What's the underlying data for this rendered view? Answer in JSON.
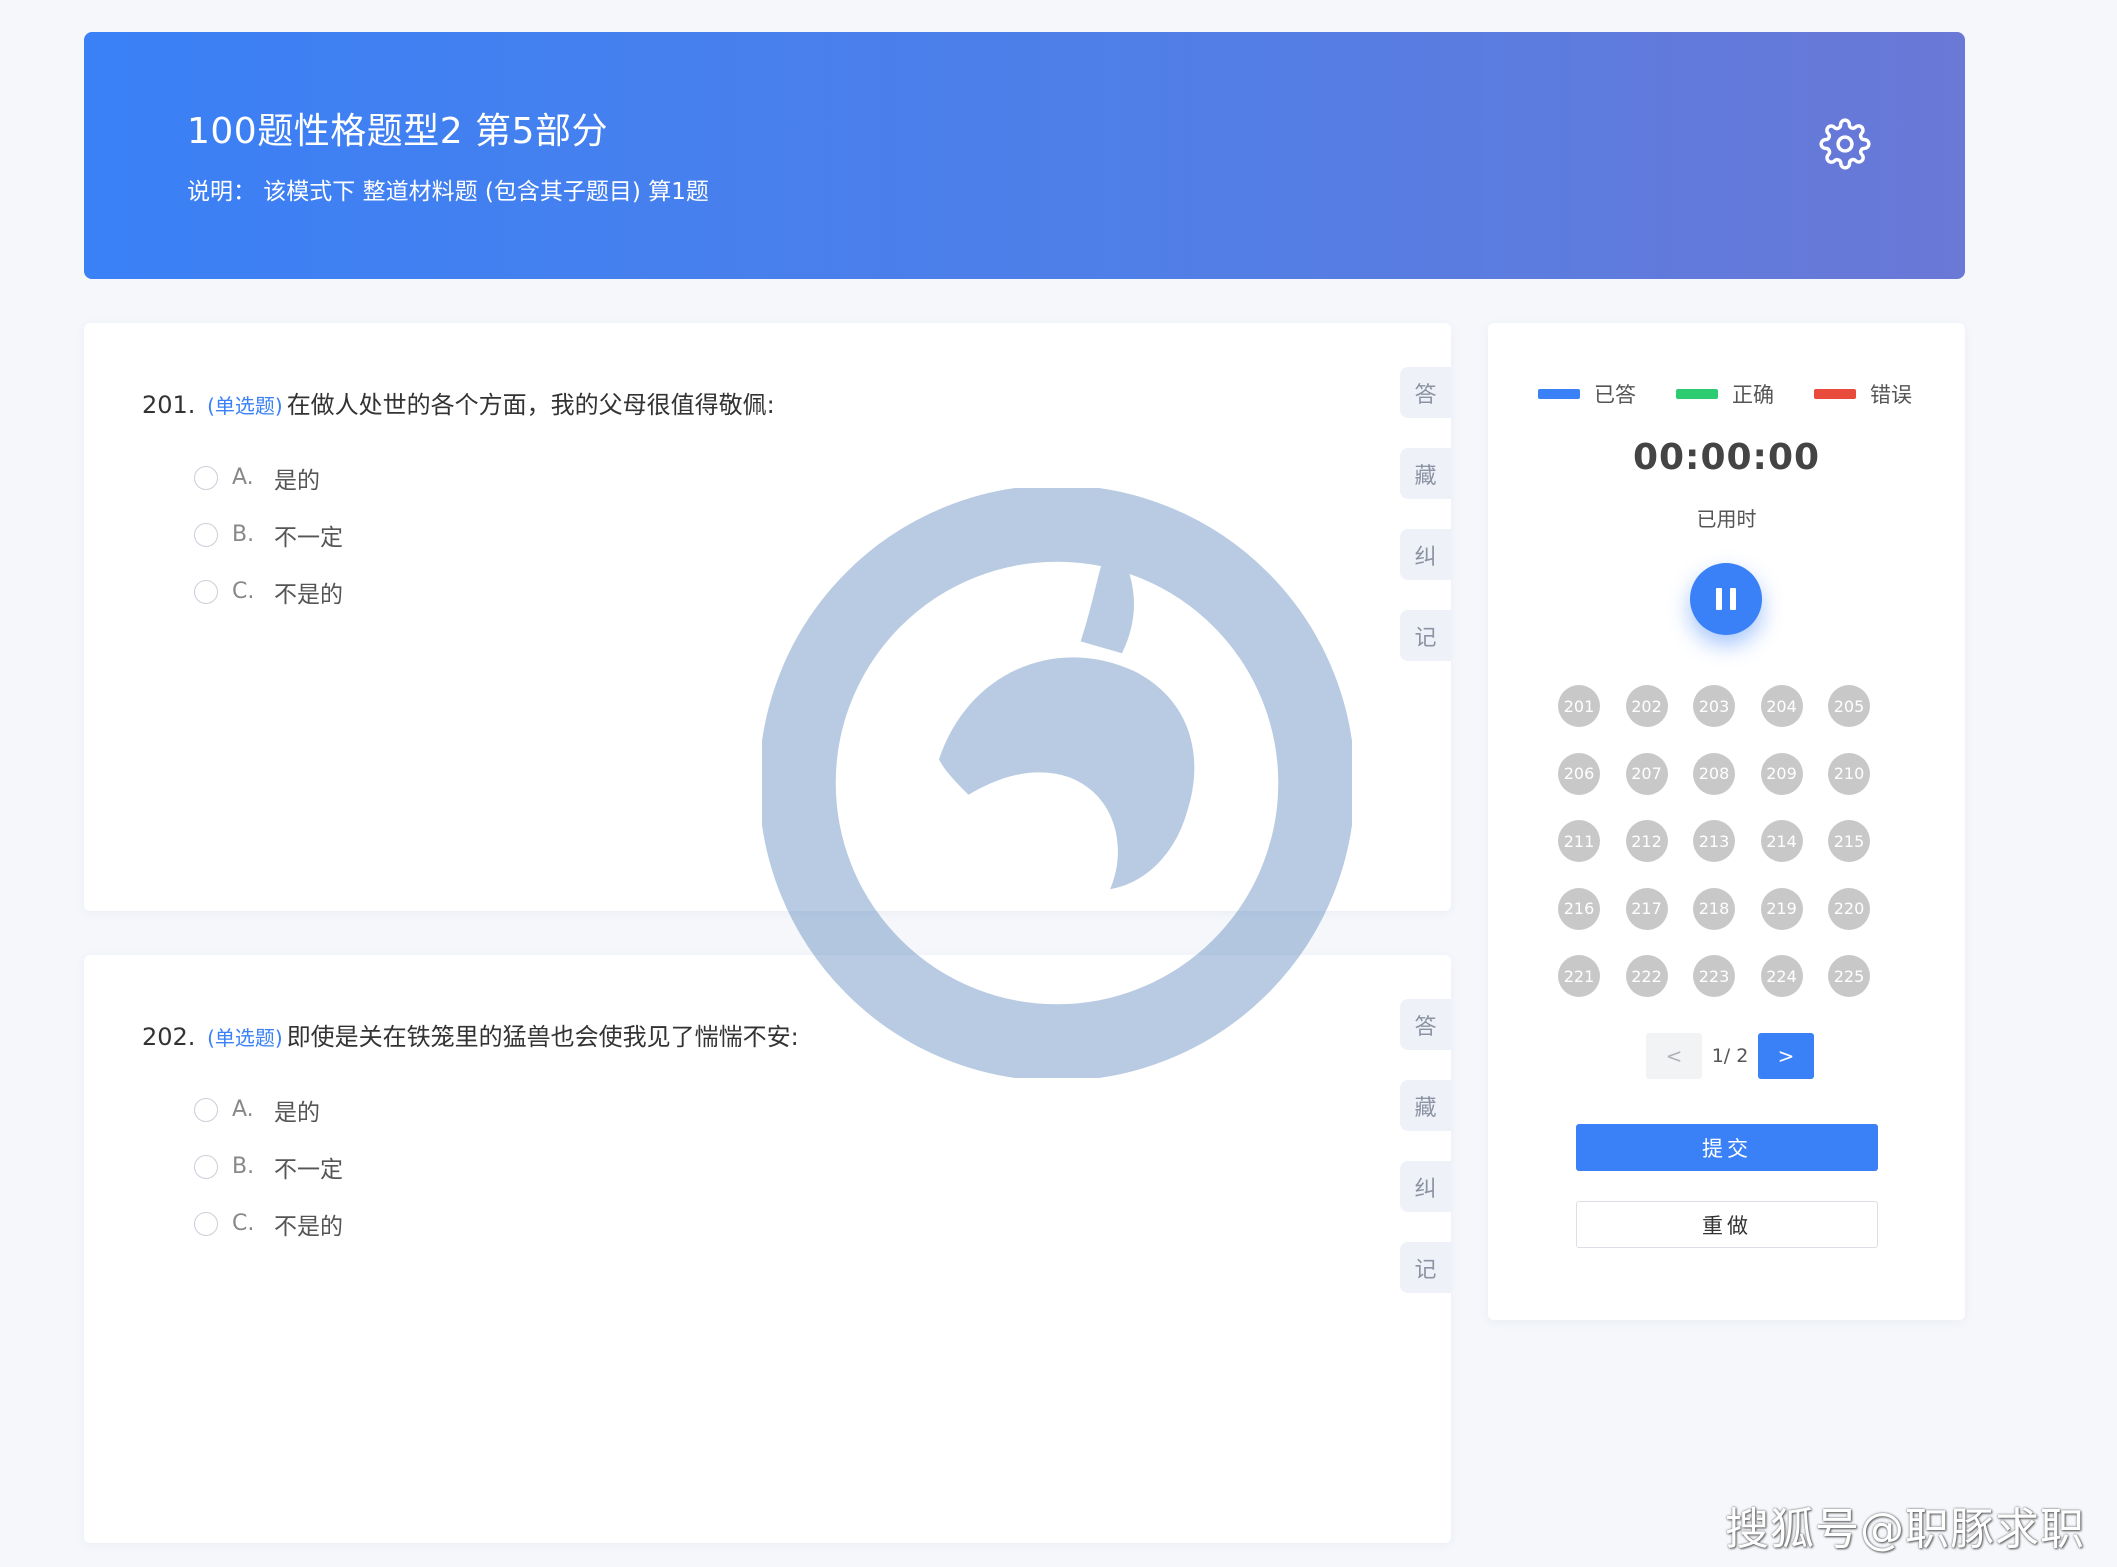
{
  "header": {
    "title": "100题性格题型2 第5部分",
    "description": "说明： 该模式下 整道材料题 (包含其子题目) 算1题"
  },
  "questions": [
    {
      "number": "201.",
      "type": "(单选题)",
      "text": "在做人处世的各个方面，我的父母很值得敬佩:",
      "options": [
        {
          "letter": "A.",
          "text": "是的"
        },
        {
          "letter": "B.",
          "text": "不一定"
        },
        {
          "letter": "C.",
          "text": "不是的"
        }
      ]
    },
    {
      "number": "202.",
      "type": "(单选题)",
      "text": "即使是关在铁笼里的猛兽也会使我见了惴惴不安:",
      "options": [
        {
          "letter": "A.",
          "text": "是的"
        },
        {
          "letter": "B.",
          "text": "不一定"
        },
        {
          "letter": "C.",
          "text": "不是的"
        }
      ]
    }
  ],
  "side_tabs": [
    "答",
    "藏",
    "纠",
    "记"
  ],
  "legend": [
    {
      "label": "已答",
      "color": "#3a80f6"
    },
    {
      "label": "正确",
      "color": "#2ecc71"
    },
    {
      "label": "错误",
      "color": "#e84a3c"
    }
  ],
  "timer": {
    "value": "00:00:00",
    "label": "已用时"
  },
  "question_numbers": [
    "201",
    "202",
    "203",
    "204",
    "205",
    "206",
    "207",
    "208",
    "209",
    "210",
    "211",
    "212",
    "213",
    "214",
    "215",
    "216",
    "217",
    "218",
    "219",
    "220",
    "221",
    "222",
    "223",
    "224",
    "225"
  ],
  "pager": {
    "prev": "<",
    "info": "1/ 2",
    "next": ">"
  },
  "buttons": {
    "submit": "提交",
    "redo": "重做"
  },
  "watermark_text": "搜狐号@职豚求职"
}
